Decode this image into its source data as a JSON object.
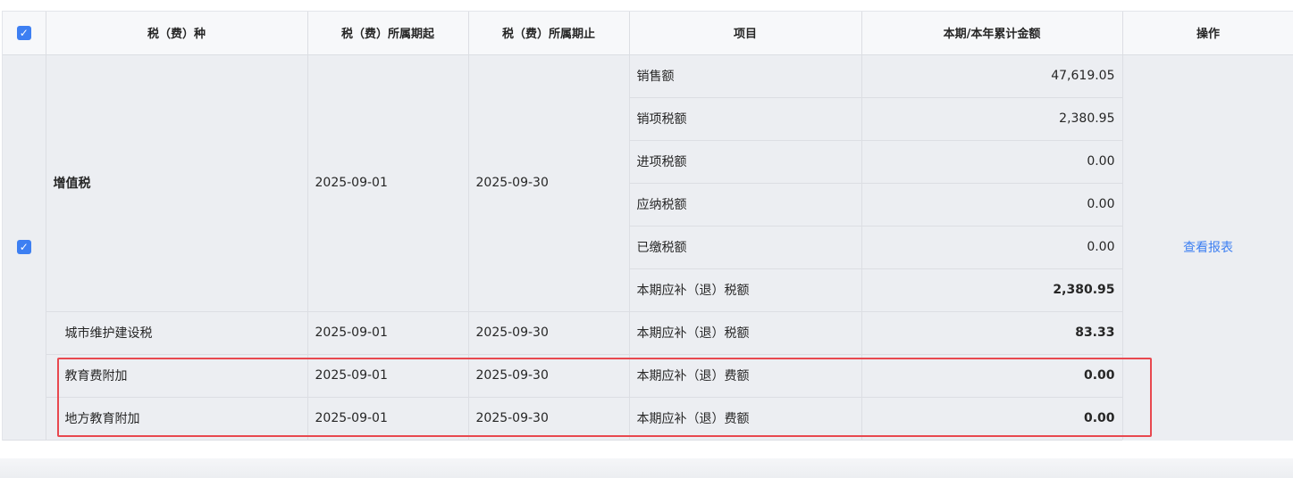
{
  "header": {
    "col_tax_type": "税（费）种",
    "col_period_start": "税（费）所属期起",
    "col_period_end": "税（费）所属期止",
    "col_item": "项目",
    "col_amount": "本期/本年累计金额",
    "col_action": "操作"
  },
  "vat": {
    "name": "增值税",
    "start": "2025-09-01",
    "end": "2025-09-30",
    "items": [
      {
        "label": "销售额",
        "amount": "47,619.05"
      },
      {
        "label": "销项税额",
        "amount": "2,380.95"
      },
      {
        "label": "进项税额",
        "amount": "0.00"
      },
      {
        "label": "应纳税额",
        "amount": "0.00"
      },
      {
        "label": "已缴税额",
        "amount": "0.00"
      },
      {
        "label": "本期应补（退）税额",
        "amount": "2,380.95"
      }
    ]
  },
  "surtaxes": [
    {
      "name": "城市维护建设税",
      "start": "2025-09-01",
      "end": "2025-09-30",
      "item": "本期应补（退）税额",
      "amount": "83.33"
    },
    {
      "name": "教育费附加",
      "start": "2025-09-01",
      "end": "2025-09-30",
      "item": "本期应补（退）费额",
      "amount": "0.00"
    },
    {
      "name": "地方教育附加",
      "start": "2025-09-01",
      "end": "2025-09-30",
      "item": "本期应补（退）费额",
      "amount": "0.00"
    }
  ],
  "action": {
    "view_report": "查看报表"
  },
  "colors": {
    "accent": "#3d7ff2",
    "highlight": "#e8484f"
  }
}
